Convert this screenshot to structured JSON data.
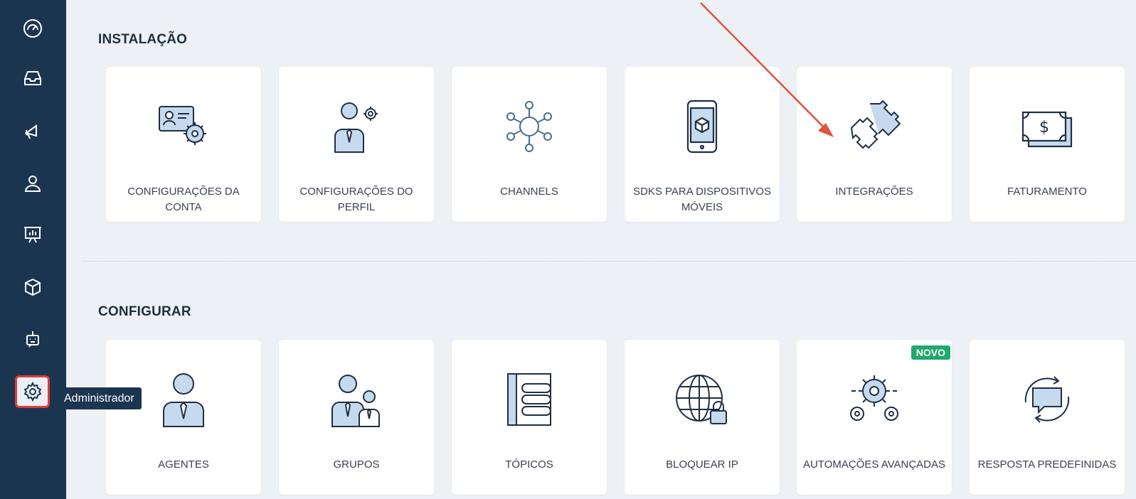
{
  "sidebar": {
    "items": [
      {
        "name": "dashboard-icon"
      },
      {
        "name": "inbox-icon"
      },
      {
        "name": "megaphone-icon"
      },
      {
        "name": "user-icon"
      },
      {
        "name": "reports-icon"
      },
      {
        "name": "cube-icon"
      },
      {
        "name": "bot-icon"
      },
      {
        "name": "gear-icon"
      }
    ],
    "tooltip": "Administrador"
  },
  "install": {
    "title": "INSTALAÇÃO",
    "cards": [
      {
        "label": "CONFIGURAÇÕES DA CONTA",
        "icon": "account-settings-icon"
      },
      {
        "label": "CONFIGURAÇÕES DO PERFIL",
        "icon": "profile-settings-icon"
      },
      {
        "label": "CHANNELS",
        "icon": "channels-icon"
      },
      {
        "label": "SDKS PARA DISPOSITIVOS MÓVEIS",
        "icon": "mobile-sdk-icon"
      },
      {
        "label": "INTEGRAÇÕES",
        "icon": "puzzle-icon"
      },
      {
        "label": "FATURAMENTO",
        "icon": "billing-icon"
      }
    ]
  },
  "configure": {
    "title": "CONFIGURAR",
    "cards": [
      {
        "label": "AGENTES",
        "icon": "agent-icon"
      },
      {
        "label": "GRUPOS",
        "icon": "groups-icon"
      },
      {
        "label": "TÓPICOS",
        "icon": "topics-icon"
      },
      {
        "label": "BLOQUEAR IP",
        "icon": "globe-lock-icon"
      },
      {
        "label": "AUTOMAÇÕES AVANÇADAS",
        "icon": "automation-gears-icon",
        "badge": "NOVO"
      },
      {
        "label": "RESPOSTA PREDEFINIDAS",
        "icon": "canned-response-icon"
      }
    ]
  },
  "colors": {
    "sidebar": "#1b3550",
    "background": "#edf0f4",
    "icon_fill": "#c5d9ef",
    "icon_stroke": "#1f2f44",
    "badge": "#22a86a",
    "highlight": "#e03c3c"
  }
}
